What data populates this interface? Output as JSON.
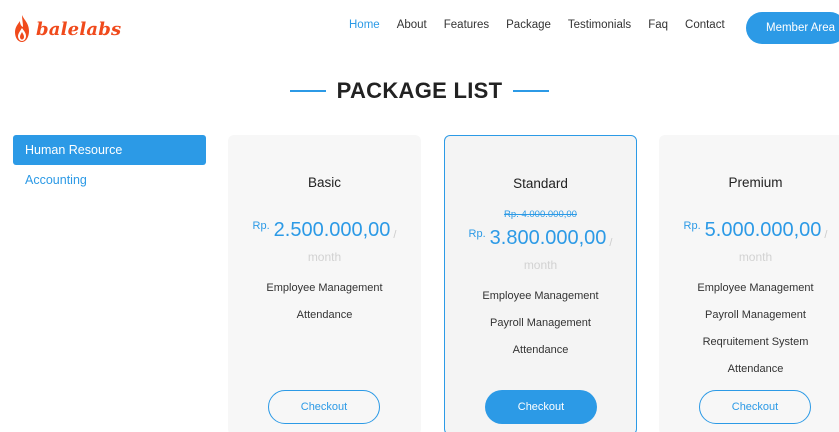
{
  "brand": {
    "name": "balelabs",
    "logo_icon": "flame-icon",
    "brand_color": "#f04a1c"
  },
  "nav": {
    "items": [
      {
        "label": "Home",
        "active": true
      },
      {
        "label": "About"
      },
      {
        "label": "Features"
      },
      {
        "label": "Package"
      },
      {
        "label": "Testimonials"
      },
      {
        "label": "Faq"
      },
      {
        "label": "Contact"
      }
    ],
    "member_label": "Member Area"
  },
  "section": {
    "title": "PACKAGE LIST"
  },
  "sidebar": {
    "items": [
      {
        "label": "Human Resource",
        "active": true
      },
      {
        "label": "Accounting"
      }
    ]
  },
  "packages": [
    {
      "name": "Basic",
      "currency": "Rp.",
      "price": "2.500.000,00",
      "separator": "/",
      "period": "month",
      "features": [
        "Employee Management",
        "Attendance"
      ],
      "button": "Checkout"
    },
    {
      "name": "Standard",
      "old_price": "Rp. 4.000.000,00",
      "currency": "Rp.",
      "price": "3.800.000,00",
      "separator": "/",
      "period": "month",
      "features": [
        "Employee Management",
        "Payroll Management",
        "Attendance"
      ],
      "button": "Checkout"
    },
    {
      "name": "Premium",
      "currency": "Rp.",
      "price": "5.000.000,00",
      "separator": "/",
      "period": "month",
      "features": [
        "Employee Management",
        "Payroll Management",
        "Reqruitement System",
        "Attendance"
      ],
      "button": "Checkout"
    }
  ],
  "colors": {
    "accent": "#2c9ae6",
    "text": "#333333",
    "muted": "#d2d2d2",
    "card_bg": "#f7f7f7"
  }
}
